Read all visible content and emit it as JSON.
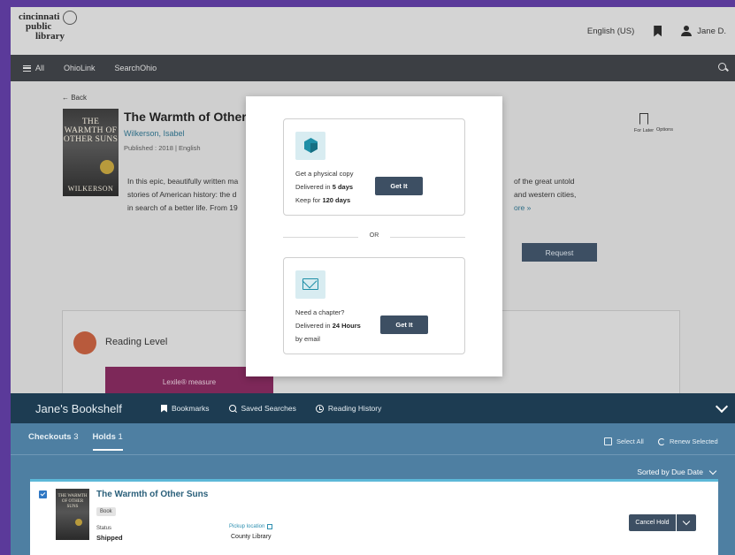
{
  "header": {
    "logo": [
      "cincinnati",
      "public",
      "library"
    ],
    "language": "English (US)",
    "user_name": "Jane D."
  },
  "nav": {
    "items": [
      {
        "label": "All",
        "icon": "menu-icon"
      },
      {
        "label": "OhioLink"
      },
      {
        "label": "SearchOhio"
      }
    ]
  },
  "book": {
    "back_label": "← Back",
    "cover_title": "THE WARMTH OF OTHER SUNS",
    "cover_author": "WILKERSON",
    "title": "The Warmth of Other S",
    "author": "Wilkerson, Isabel",
    "meta": "Published : 2018 | English",
    "desc_left": [
      "In this epic, beautifully written ma",
      "stories of American history: the d",
      "in search of a better life. From 19"
    ],
    "desc_right": [
      "of the great untold",
      "and western cities,"
    ],
    "more": "ore »",
    "for_later": "For Later",
    "options": "Options",
    "request": "Request"
  },
  "reading": {
    "label": "Reading Level",
    "lexile": "Lexile® measure"
  },
  "modal": {
    "physical": {
      "line1": "Get a physical copy",
      "line2_prefix": "Delivered in ",
      "line2_bold": "5 days",
      "line3_prefix": "Keep for ",
      "line3_bold": "120 days",
      "button": "Get It"
    },
    "or": "OR",
    "chapter": {
      "line1": "Need a chapter?",
      "line2_prefix": "Delivered in ",
      "line2_bold": "24 Hours",
      "line3": "by email",
      "button": "Get It"
    }
  },
  "bookshelf": {
    "title": "Jane's Bookshelf",
    "tabs": [
      {
        "label": "Bookmarks",
        "icon": "bookmark-icon"
      },
      {
        "label": "Saved Searches",
        "icon": "search-icon"
      },
      {
        "label": "Reading History",
        "icon": "history-icon"
      }
    ],
    "sub_tabs": [
      {
        "label": "Checkouts",
        "count": "3"
      },
      {
        "label": "Holds",
        "count": "1"
      }
    ],
    "select_all": "Select All",
    "renew_selected": "Renew Selected",
    "sorted_by": "Sorted by Due Date",
    "hold": {
      "title": "The Warmth of Other Suns",
      "badge": "Book",
      "status_label": "Status",
      "status_value": "Shipped",
      "pickup_label": "Pickup location",
      "pickup_value": "County Library",
      "cancel": "Cancel Hold"
    }
  }
}
